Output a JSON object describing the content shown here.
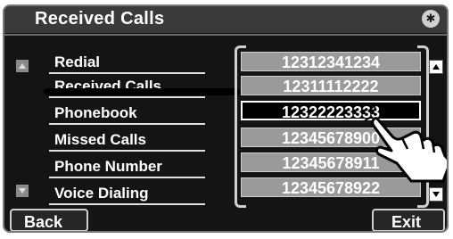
{
  "window": {
    "title": "Received Calls"
  },
  "header": {
    "bluetooth_icon": "bluetooth-icon"
  },
  "menu": {
    "items": [
      {
        "label": "Redial"
      },
      {
        "label": "Received Calls"
      },
      {
        "label": "Phonebook"
      },
      {
        "label": "Missed Calls"
      },
      {
        "label": "Phone Number"
      },
      {
        "label": "Voice Dialing"
      }
    ],
    "up_icon": "arrow-up-icon",
    "down_icon": "arrow-down-icon"
  },
  "numbers": {
    "items": [
      "12312341234",
      "12311112222",
      "12322223333",
      "12345678900",
      "12345678911",
      "12345678922"
    ],
    "selected_index": 2
  },
  "buttons": {
    "back": "Back",
    "exit": "Exit"
  },
  "colors": {
    "panel_bg": "#141414",
    "title_bg": "#3a3a3a",
    "number_bg": "#9a9a9a",
    "selected_bg": "#000000"
  },
  "illustration": {
    "hand_icon": "pointing-hand-icon"
  }
}
